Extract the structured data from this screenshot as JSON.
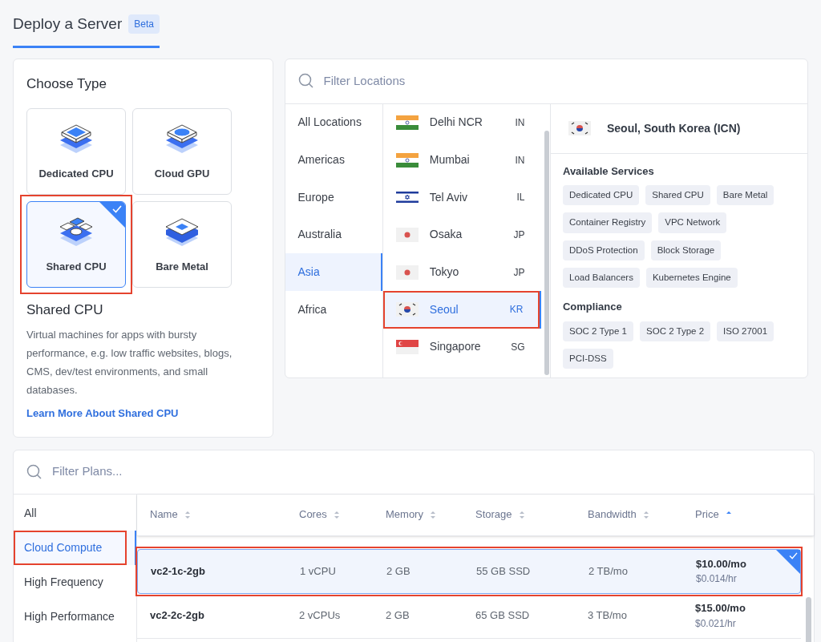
{
  "header": {
    "title": "Deploy a Server",
    "badge": "Beta"
  },
  "choose_type": {
    "title": "Choose Type",
    "types": [
      {
        "kind": "dedicated",
        "label": "Dedicated CPU",
        "selected": false,
        "highlighted": false
      },
      {
        "kind": "gpu",
        "label": "Cloud GPU",
        "selected": false,
        "highlighted": false
      },
      {
        "kind": "shared",
        "label": "Shared CPU",
        "selected": true,
        "highlighted": true
      },
      {
        "kind": "metal",
        "label": "Bare Metal",
        "selected": false,
        "highlighted": false
      }
    ],
    "description_title": "Shared CPU",
    "description": "Virtual machines for apps with bursty performance, e.g. low traffic websites, blogs, CMS, dev/test environments, and small databases.",
    "link": "Learn More About Shared CPU"
  },
  "locations": {
    "search": {
      "placeholder": "Filter Locations"
    },
    "regions": [
      {
        "label": "All Locations",
        "selected": false
      },
      {
        "label": "Americas",
        "selected": false
      },
      {
        "label": "Europe",
        "selected": false
      },
      {
        "label": "Australia",
        "selected": false
      },
      {
        "label": "Asia",
        "selected": true
      },
      {
        "label": "Africa",
        "selected": false
      }
    ],
    "cities": [
      {
        "kind": "india",
        "name": "Delhi NCR",
        "code": "IN",
        "selected": false,
        "highlighted": false
      },
      {
        "kind": "india",
        "name": "Mumbai",
        "code": "IN",
        "selected": false,
        "highlighted": false
      },
      {
        "kind": "israel",
        "name": "Tel Aviv",
        "code": "IL",
        "selected": false,
        "highlighted": false
      },
      {
        "kind": "japan",
        "name": "Osaka",
        "code": "JP",
        "selected": false,
        "highlighted": false
      },
      {
        "kind": "japan",
        "name": "Tokyo",
        "code": "JP",
        "selected": false,
        "highlighted": false
      },
      {
        "kind": "korea",
        "name": "Seoul",
        "code": "KR",
        "selected": true,
        "highlighted": true
      },
      {
        "kind": "singapore",
        "name": "Singapore",
        "code": "SG",
        "selected": false,
        "highlighted": false
      }
    ],
    "detail": {
      "name": "Seoul, South Korea (ICN)",
      "services_title": "Available Services",
      "services": [
        "Dedicated CPU",
        "Shared CPU",
        "Bare Metal",
        "Container Registry",
        "VPC Network",
        "DDoS Protection",
        "Block Storage",
        "Load Balancers",
        "Kubernetes Engine"
      ],
      "compliance_title": "Compliance",
      "compliance": [
        "SOC 2 Type 1",
        "SOC 2 Type 2",
        "ISO 27001",
        "PCI-DSS"
      ]
    }
  },
  "plans": {
    "search": {
      "placeholder": "Filter Plans..."
    },
    "categories": [
      {
        "label": "All",
        "selected": false,
        "highlighted": false
      },
      {
        "label": "Cloud Compute",
        "selected": true,
        "highlighted": true
      },
      {
        "label": "High Frequency",
        "selected": false,
        "highlighted": false
      },
      {
        "label": "High Performance",
        "selected": false,
        "highlighted": false
      }
    ],
    "columns": [
      {
        "label": "Name",
        "sorted": false
      },
      {
        "label": "Cores",
        "sorted": false
      },
      {
        "label": "Memory",
        "sorted": false
      },
      {
        "label": "Storage",
        "sorted": false
      },
      {
        "label": "Bandwidth",
        "sorted": false
      },
      {
        "label": "Price",
        "sorted": true
      }
    ],
    "rows": [
      {
        "name": "vc2-1c-2gb",
        "cores": "1 vCPU",
        "memory": "2 GB",
        "storage": "55 GB SSD",
        "bandwidth": "2 TB/mo",
        "price_month": "$10.00/mo",
        "price_hour": "$0.014/hr",
        "selected": true,
        "highlighted": true
      },
      {
        "name": "vc2-2c-2gb",
        "cores": "2 vCPUs",
        "memory": "2 GB",
        "storage": "65 GB SSD",
        "bandwidth": "3 TB/mo",
        "price_month": "$15.00/mo",
        "price_hour": "$0.021/hr",
        "selected": false,
        "highlighted": false
      }
    ]
  }
}
